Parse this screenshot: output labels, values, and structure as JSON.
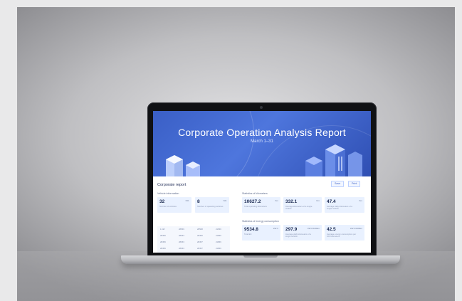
{
  "report": {
    "banner_title": "Corporate Operation Analysis Report",
    "banner_subtitle": "March 1–31",
    "section_title": "Corporate report",
    "buttons": [
      "Save",
      "Print"
    ]
  },
  "vehicle_info": {
    "heading": "Vehicle information",
    "cards": [
      {
        "value": "32",
        "unit": "NO.",
        "label": "Number of vehicles"
      },
      {
        "value": "8",
        "unit": "NO.",
        "label": "Number of operating vehicles"
      }
    ],
    "table": [
      [
        "1 kW",
        "28569",
        "28568",
        "21566"
      ],
      [
        "28456",
        "28453",
        "28450",
        "21866"
      ],
      [
        "28456",
        "28453",
        "28457",
        "21866"
      ],
      [
        "28456",
        "28453",
        "28457",
        "21866"
      ]
    ]
  },
  "km_stats": {
    "heading": "Statistics of kilometers",
    "cards": [
      {
        "value": "10627.2",
        "unit": "Km",
        "label": "Total operating kilometers"
      },
      {
        "value": "332.1",
        "unit": "Km",
        "label": "Average kilometers of a single vehicle"
      },
      {
        "value": "47.4",
        "unit": "Km",
        "label": "Average daily kilometers of a single vehicle"
      }
    ]
  },
  "energy_stats": {
    "heading": "Statistics of energy consumption",
    "cards": [
      {
        "value": "9534.8",
        "unit": "kW·h",
        "label": "Total EC"
      },
      {
        "value": "297.9",
        "unit": "kW·h/100km",
        "label": "Average daily kilometers of a single vehicle"
      },
      {
        "value": "42.5",
        "unit": "kW·h/100km",
        "label": "Average energy consumption per 100 kilometers"
      }
    ]
  },
  "colors": {
    "banner": "#3a5fc6",
    "card": "#e9f1ff",
    "text": "#1d2b52"
  }
}
